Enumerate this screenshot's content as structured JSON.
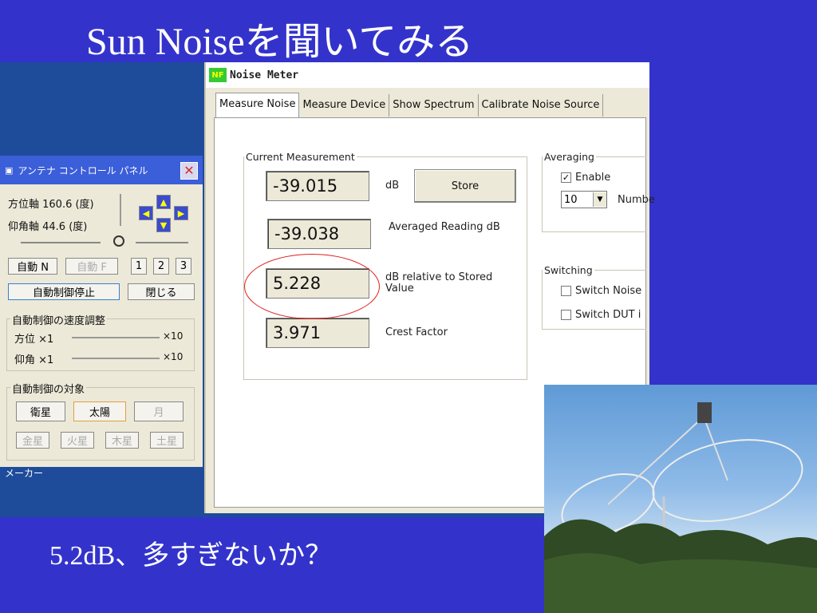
{
  "slide": {
    "title": "Sun Noiseを聞いてみる",
    "caption": "5.2dB、多すぎないか？"
  },
  "desktop": {
    "label": "メーカー"
  },
  "noise_meter": {
    "logo": "NF",
    "title": "Noise Meter",
    "tabs": [
      "Measure Noise",
      "Measure Device",
      "Show Spectrum",
      "Calibrate Noise Source"
    ],
    "current": {
      "legend": "Current Measurement",
      "reading": "-39.015",
      "reading_unit": "dB",
      "store_label": "Store",
      "averaged": "-39.038",
      "averaged_label": "Averaged Reading dB",
      "relative": "5.228",
      "relative_label": "dB relative to Stored Value",
      "crest": "3.971",
      "crest_label": "Crest Factor"
    },
    "averaging": {
      "legend": "Averaging",
      "enable_label": "Enable",
      "enable_checked": true,
      "count": "10",
      "number_label": "Numbe"
    },
    "switching": {
      "legend": "Switching",
      "noise_label": "Switch Noise",
      "dut_label": "Switch DUT i"
    },
    "highlight_color": "#e02020"
  },
  "antenna_panel": {
    "title": "アンテナ コントロール パネル",
    "azimuth": "方位軸 160.6 (度)",
    "elevation": "仰角軸 44.6 (度)",
    "buttons": {
      "auto_n": "自動 N",
      "auto_f": "自動 F",
      "b1": "1",
      "b2": "2",
      "b3": "3",
      "stop": "自動制御停止",
      "close": "閉じる"
    },
    "speed": {
      "legend": "自動制御の速度調整",
      "az_label": "方位 ×1",
      "el_label": "仰角 ×1",
      "max_label": "×10"
    },
    "target": {
      "legend": "自動制御の対象",
      "satellite": "衛星",
      "sun": "太陽",
      "moon": "月",
      "venus": "金星",
      "mars": "火星",
      "jupiter": "木星",
      "saturn": "土星"
    }
  }
}
